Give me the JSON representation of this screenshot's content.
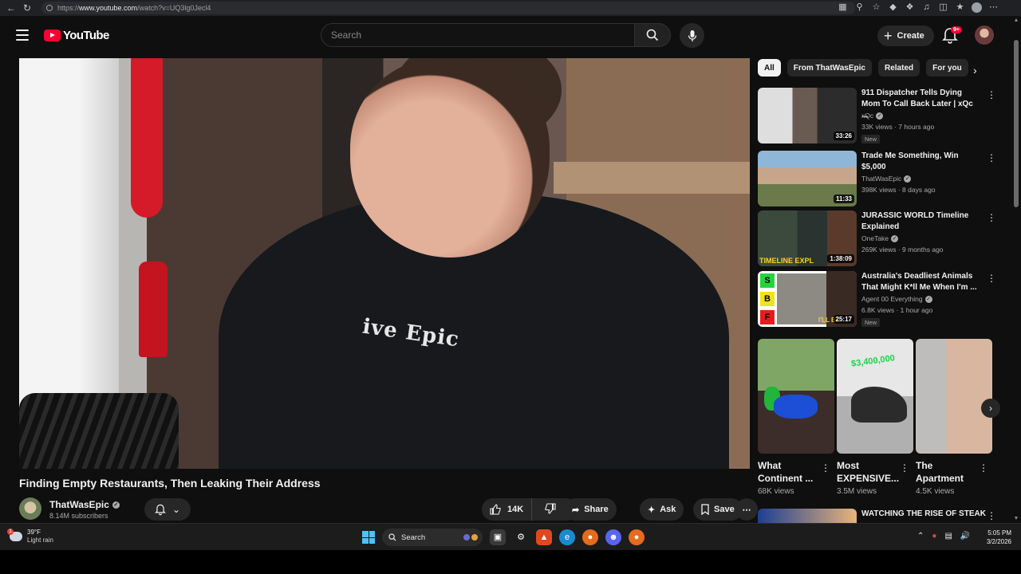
{
  "browser": {
    "url_prefix": "https://",
    "url_host": "www.youtube.com",
    "url_path": "/watch?v=UQ3lg0Jecl4"
  },
  "header": {
    "logo_text": "YouTube",
    "search_placeholder": "Search",
    "create_label": "Create",
    "notification_badge": "9+"
  },
  "video": {
    "title": "Finding Empty Restaurants, Then Leaking Their Address",
    "hoodie_print": "ive Epic",
    "channel": "ThatWasEpic",
    "subscribers": "8.14M subscribers",
    "like_count": "14K",
    "share_label": "Share",
    "ask_label": "Ask",
    "save_label": "Save"
  },
  "chips": [
    "All",
    "From ThatWasEpic",
    "Related",
    "For you"
  ],
  "recommendations": [
    {
      "title": "911 Dispatcher Tells Dying Mom To Call Back Later | xQc ...",
      "channel": "xQc",
      "meta": "33K views · 7 hours ago",
      "duration": "33:26",
      "badge": "New"
    },
    {
      "title": "Trade Me Something, Win $5,000",
      "channel": "ThatWasEpic",
      "meta": "398K views · 8 days ago",
      "duration": "11:33",
      "badge": ""
    },
    {
      "title": "JURASSIC WORLD Timeline Explained",
      "channel": "OneTake",
      "meta": "269K views · 9 months ago",
      "duration": "1:38:09",
      "badge": "",
      "thumb_text": "TIMELINE EXPL"
    },
    {
      "title": "Australia's Deadliest Animals That Might K*ll Me When I'm ...",
      "channel": "Agent 00 Everything",
      "meta": "6.8K views · 1 hour ago",
      "duration": "25:17",
      "badge": "New",
      "tiers": [
        "S",
        "B",
        "F"
      ],
      "thumb_text": "I'LL BE"
    }
  ],
  "shorts": [
    {
      "title": "What Continent ...",
      "views": "68K views"
    },
    {
      "title": "Most EXPENSIVE...",
      "views": "3.5M views",
      "thumb_text": "$3,400,000"
    },
    {
      "title": "The Apartment",
      "views": "4.5K views"
    }
  ],
  "next_rec": {
    "title": "WATCHING THE RISE OF STEAK"
  },
  "taskbar": {
    "weather_temp": "39°F",
    "weather_desc": "Light rain",
    "weather_badge": "1",
    "search_label": "Search",
    "time": "5:05 PM",
    "date": "3/2/2026"
  },
  "colors": {
    "background": "#0f0f0f",
    "accent": "#ff0033",
    "chip_active": "#f1f1f1",
    "muted_text": "#aaaaaa"
  }
}
